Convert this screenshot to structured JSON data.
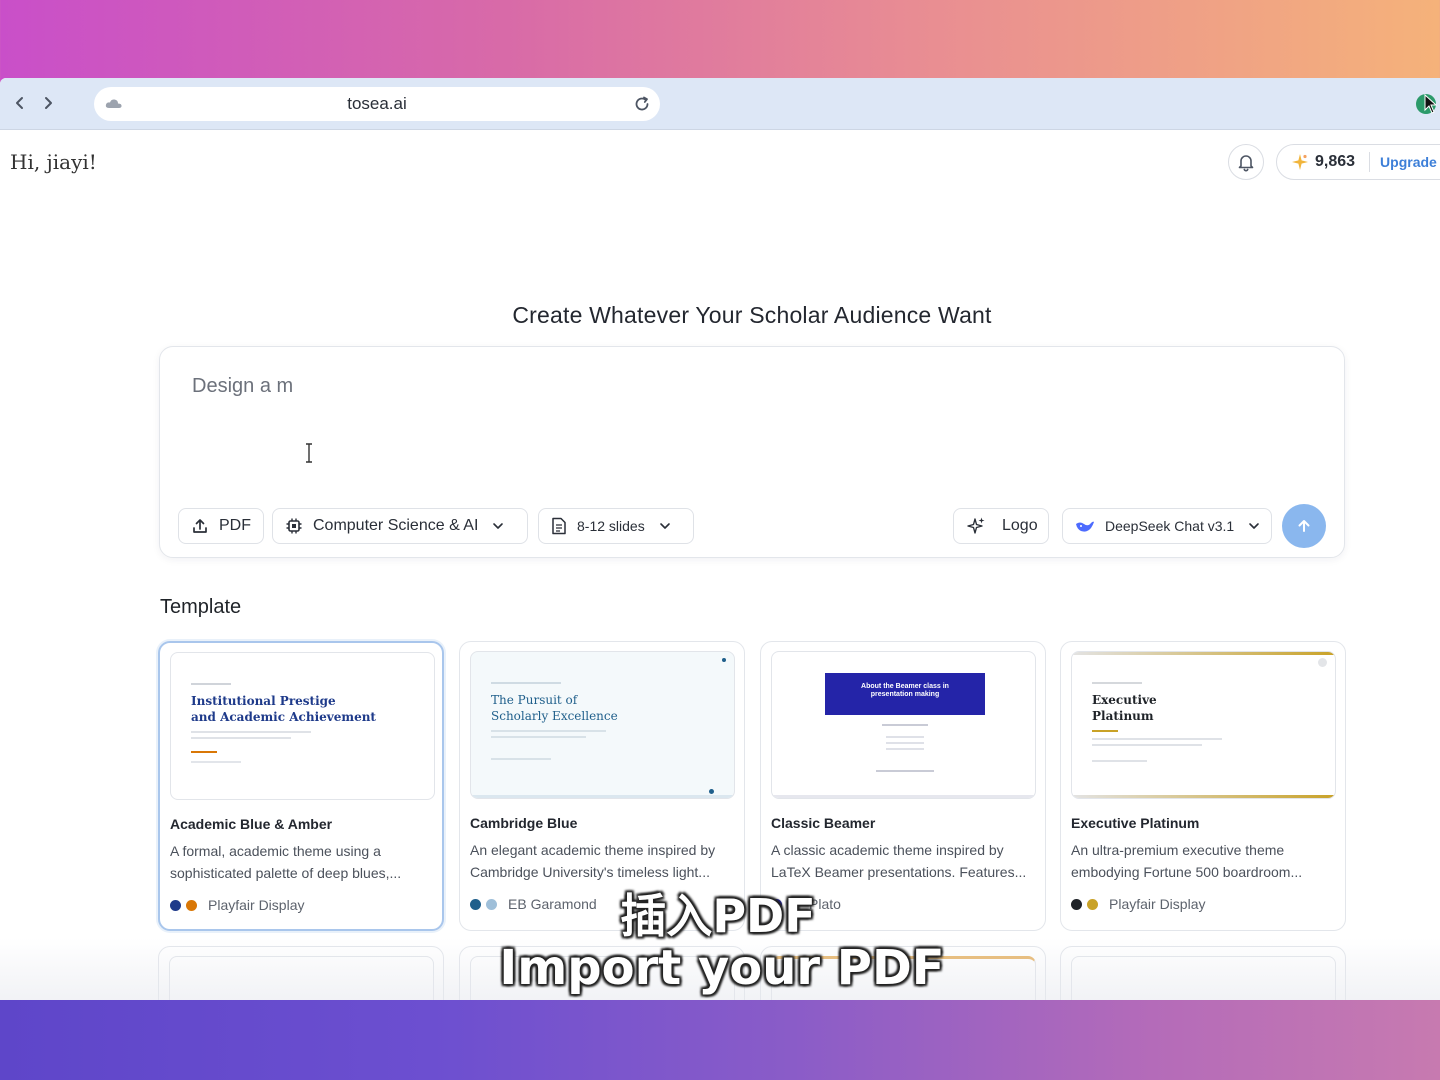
{
  "browser": {
    "url": "tosea.ai"
  },
  "header": {
    "greeting": "Hi, jiayi!",
    "credits": "9,863",
    "upgrade_label": "Upgrade"
  },
  "hero": {
    "title": "Create Whatever Your Scholar Audience Want",
    "prompt_value": "Design a m"
  },
  "toolbar": {
    "pdf_label": "PDF",
    "category_label": "Computer Science & AI",
    "slides_label": "8-12 slides",
    "logo_label": "Logo",
    "model_label": "DeepSeek Chat v3.1"
  },
  "templates": {
    "section_title": "Template",
    "items": [
      {
        "name": "Academic Blue & Amber",
        "description": "A formal, academic theme using a sophisticated palette of deep blues,...",
        "font": "Playfair Display",
        "colors": [
          "#1e3a8a",
          "#d97706"
        ],
        "thumb_title_1": "Institutional Prestige",
        "thumb_title_2": "and Academic Achievement"
      },
      {
        "name": "Cambridge Blue",
        "description": "An elegant academic theme inspired by Cambridge University's timeless light...",
        "font": "EB Garamond",
        "colors": [
          "#1f5f8b",
          "#9fbfd9"
        ],
        "thumb_title_1": "The Pursuit of",
        "thumb_title_2": "Scholarly Excellence"
      },
      {
        "name": "Classic Beamer",
        "description": "A classic academic theme inspired by LaTeX Beamer presentations. Features...",
        "font": "Plato",
        "colors": [
          "#2424a8",
          "#8a8ad6"
        ],
        "thumb_title_1": "About the Beamer class in",
        "thumb_title_2": "presentation making"
      },
      {
        "name": "Executive Platinum",
        "description": "An ultra-premium executive theme embodying Fortune 500 boardroom...",
        "font": "Playfair Display",
        "colors": [
          "#1f2328",
          "#c9a227"
        ],
        "thumb_title_1": "Executive",
        "thumb_title_2": "Platinum"
      }
    ]
  },
  "overlay": {
    "subtitle_cn": "插入PDF",
    "subtitle_en": "Import your PDF"
  }
}
